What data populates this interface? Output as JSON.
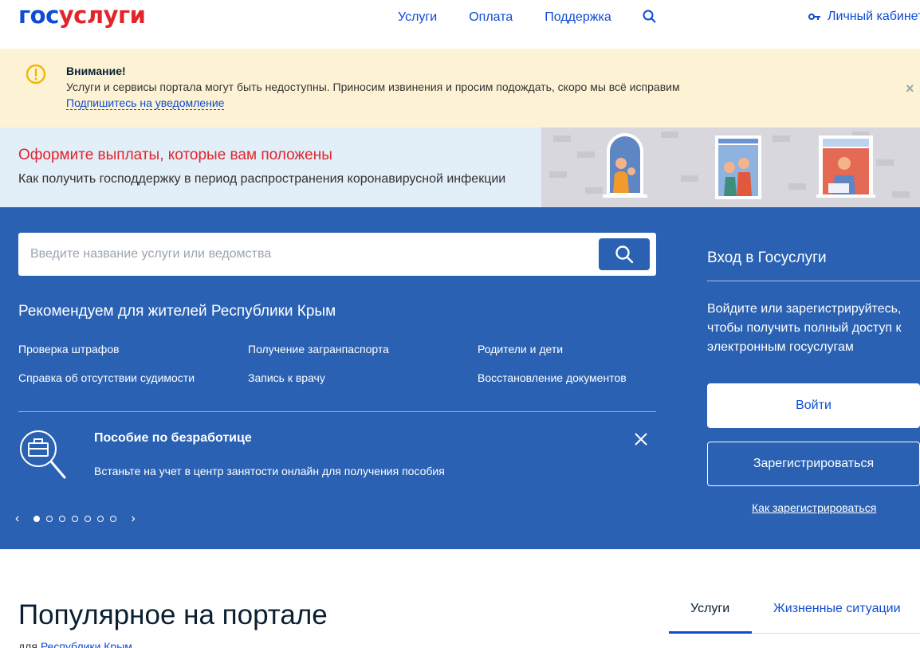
{
  "header": {
    "logo_part1": "гос",
    "logo_part2": "услуги",
    "nav": [
      "Услуги",
      "Оплата",
      "Поддержка"
    ],
    "cabinet": "Личный кабинет"
  },
  "alert": {
    "title": "Внимание!",
    "text": "Услуги и сервисы портала могут быть недоступны. Приносим извинения и просим подождать, скоро мы всё исправим",
    "link": "Подпишитесь на уведомление",
    "close": "×"
  },
  "promo": {
    "title": "Оформите выплаты, которые вам положены",
    "subtitle": "Как получить господдержку в период распространения коронавирусной инфекции"
  },
  "search": {
    "placeholder": "Введите название услуги или ведомства"
  },
  "recommend": {
    "title": "Рекомендуем для жителей Республики Крым",
    "links": [
      "Проверка штрафов",
      "Получение загранпаспорта",
      "Родители и дети",
      "Справка об отсутствии судимости",
      "Запись к врачу",
      "Восстановление документов"
    ]
  },
  "slide": {
    "title": "Пособие по безработице",
    "text": "Встаньте на учет в центр занятости онлайн для получения пособия",
    "prev": "‹",
    "next": "›"
  },
  "login": {
    "title": "Вход в Госуслуги",
    "text": "Войдите или зарегистрируйтесь, чтобы получить полный доступ к электронным госуслугам",
    "login_button": "Войти",
    "register_button": "Зарегистрироваться",
    "how_register": "Как зарегистрироваться"
  },
  "popular": {
    "title": "Популярное на портале",
    "sub_prefix": "для",
    "sub_region": "Республики Крым",
    "tabs": [
      "Услуги",
      "Жизненные ситуации"
    ]
  },
  "colors": {
    "brand_blue": "#0d4cd3",
    "brand_red": "#e3242b",
    "section_blue": "#2a61b3",
    "alert_bg": "#fdf3d4"
  }
}
